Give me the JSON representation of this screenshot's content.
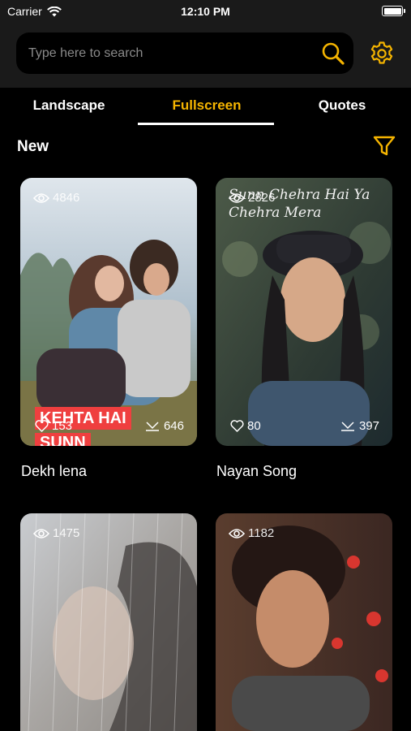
{
  "status_bar": {
    "carrier": "Carrier",
    "time": "12:10 PM"
  },
  "search": {
    "placeholder": "Type here to search"
  },
  "tabs": [
    {
      "label": "Landscape",
      "active": false
    },
    {
      "label": "Fullscreen",
      "active": true
    },
    {
      "label": "Quotes",
      "active": false
    }
  ],
  "section": {
    "title": "New"
  },
  "colors": {
    "accent": "#f5b400",
    "background": "#000000",
    "topbar": "#1a1a1a",
    "tab_active_underline": "#ffffff"
  },
  "cards": [
    {
      "title": "Dekh lena",
      "views": "4846",
      "likes": "153",
      "downloads": "646",
      "overlay_line1": "KEHTA HAI",
      "overlay_line2": "SUNN"
    },
    {
      "title": "Nayan Song",
      "views": "2826",
      "likes": "80",
      "downloads": "397",
      "overlay_lyric": "Sunn Chehra Hai Ya Chehra Mera"
    },
    {
      "title": "",
      "views": "1475"
    },
    {
      "title": "",
      "views": "1182"
    }
  ],
  "icons": {
    "search": "search-icon",
    "settings": "gear-icon",
    "filter": "filter-icon",
    "views": "eye-icon",
    "likes": "heart-icon",
    "downloads": "download-icon"
  }
}
